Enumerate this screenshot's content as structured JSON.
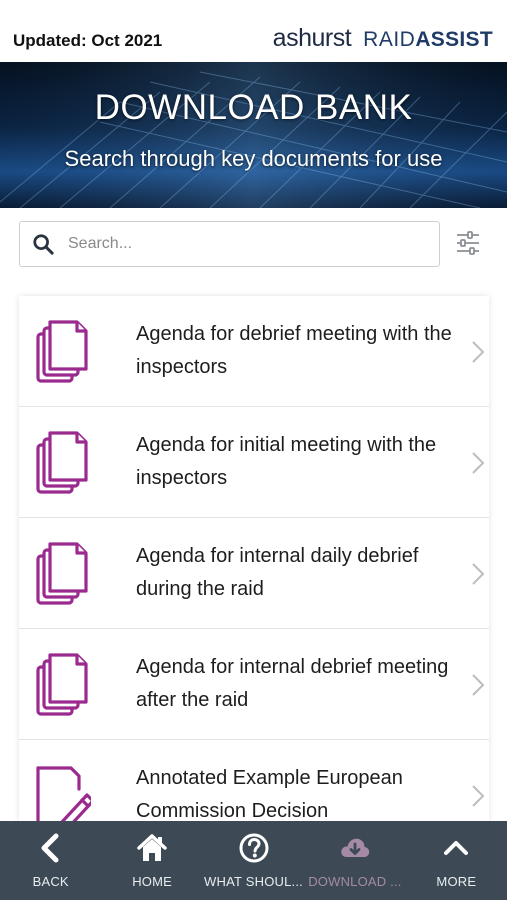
{
  "header": {
    "updated": "Updated: Oct 2021",
    "brand_ashurst": "ashurst",
    "brand_raid": "RAID",
    "brand_assist": "ASSIST"
  },
  "hero": {
    "title": "DOWNLOAD BANK",
    "subtitle": "Search through key documents for use"
  },
  "search": {
    "placeholder": "Search...",
    "value": "",
    "icon": "search-icon",
    "filter_icon": "sliders-icon"
  },
  "documents": [
    {
      "label": "Agenda for debrief meeting with the inspectors",
      "icon": "documents-stack-icon"
    },
    {
      "label": "Agenda for initial meeting with the inspectors",
      "icon": "documents-stack-icon"
    },
    {
      "label": "Agenda for internal daily debrief during the raid",
      "icon": "documents-stack-icon"
    },
    {
      "label": "Agenda for internal debrief meeting after the raid",
      "icon": "documents-stack-icon"
    },
    {
      "label": "Annotated Example European Commission Decision",
      "icon": "document-edit-icon"
    }
  ],
  "bottom_nav": {
    "items": [
      {
        "label": "BACK",
        "icon": "chevron-left-icon"
      },
      {
        "label": "HOME",
        "icon": "home-icon"
      },
      {
        "label": "WHAT SHOUL...",
        "icon": "question-circle-icon"
      },
      {
        "label": "DOWNLOAD ...",
        "icon": "cloud-download-icon",
        "active": true
      },
      {
        "label": "MORE",
        "icon": "chevron-up-icon"
      }
    ]
  },
  "colors": {
    "accent_purple": "#9b2a8f",
    "nav_background": "#3d4a55",
    "nav_active": "#a58aa5",
    "brand_navy": "#1f3b66"
  }
}
